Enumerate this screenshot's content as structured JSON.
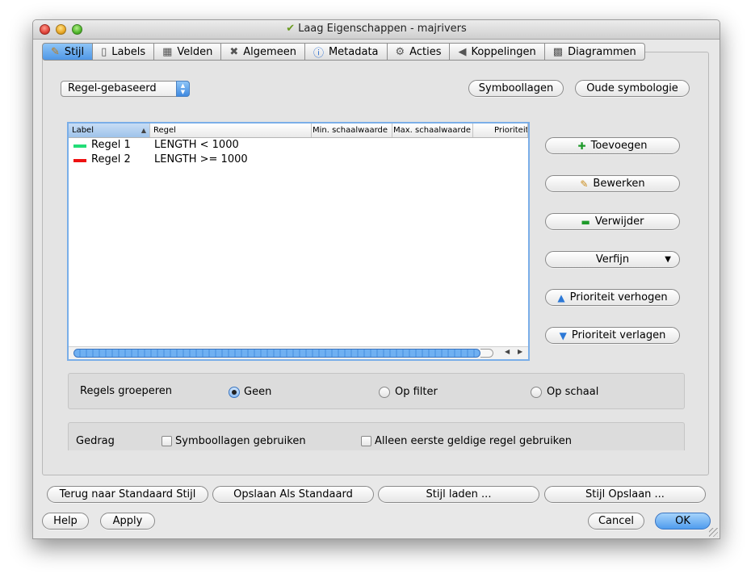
{
  "window": {
    "title": "Laag Eigenschappen - majrivers"
  },
  "tabs": [
    {
      "label": "Stijl",
      "icon": "paintbrush-icon",
      "active": true
    },
    {
      "label": "Labels",
      "icon": "label-icon"
    },
    {
      "label": "Velden",
      "icon": "table-icon"
    },
    {
      "label": "Algemeen",
      "icon": "tools-icon"
    },
    {
      "label": "Metadata",
      "icon": "info-icon"
    },
    {
      "label": "Acties",
      "icon": "gears-icon"
    },
    {
      "label": "Koppelingen",
      "icon": "join-icon"
    },
    {
      "label": "Diagrammen",
      "icon": "chart-icon"
    }
  ],
  "renderer": {
    "selected": "Regel-gebaseerd"
  },
  "top_buttons": {
    "symbol_levels": "Symboollagen",
    "old_symbology": "Oude symbologie"
  },
  "rules_table": {
    "columns": [
      "Label",
      "Regel",
      "Min. schaalwaarde",
      "Max. schaalwaarde",
      "Prioriteit"
    ],
    "rows": [
      {
        "label": "Regel 1",
        "rule": "LENGTH < 1000",
        "color": "#22dd77"
      },
      {
        "label": "Regel 2",
        "rule": "LENGTH >= 1000",
        "color": "#ee1111"
      }
    ]
  },
  "side_buttons": {
    "add": "Toevoegen",
    "edit": "Bewerken",
    "remove": "Verwijder",
    "refine": "Verfijn",
    "raise_priority": "Prioriteit verhogen",
    "lower_priority": "Prioriteit verlagen"
  },
  "grouping": {
    "label": "Regels groeperen",
    "options": [
      {
        "label": "Geen",
        "selected": true
      },
      {
        "label": "Op filter",
        "selected": false
      },
      {
        "label": "Op schaal",
        "selected": false
      }
    ]
  },
  "behavior": {
    "label": "Gedrag",
    "use_symbol_levels": "Symboollagen gebruiken",
    "first_rule_only": "Alleen eerste geldige regel gebruiken"
  },
  "style_buttons": {
    "reset": "Terug naar Standaard Stijl",
    "save_default": "Opslaan Als Standaard",
    "load": "Stijl laden ...",
    "save": "Stijl Opslaan ..."
  },
  "dialog_buttons": {
    "help": "Help",
    "apply": "Apply",
    "cancel": "Cancel",
    "ok": "OK"
  }
}
